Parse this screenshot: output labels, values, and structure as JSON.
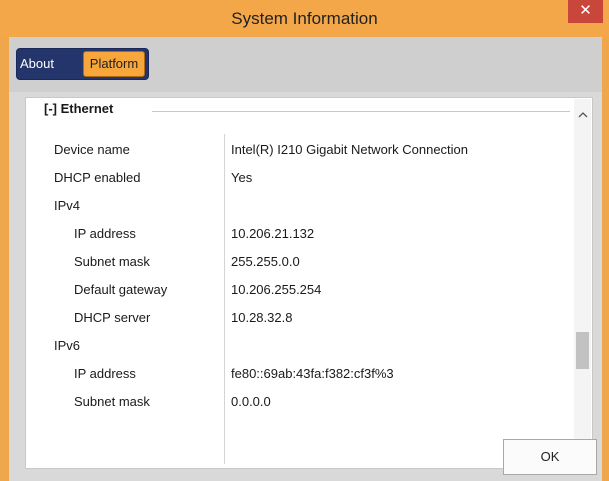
{
  "window": {
    "title": "System Information",
    "close_glyph": "✕",
    "accent_color": "#f3a748",
    "close_color": "#c9463a"
  },
  "tabs": [
    {
      "label": "About",
      "selected": false
    },
    {
      "label": "Platform",
      "selected": true
    }
  ],
  "section": {
    "header": "[-] Ethernet"
  },
  "rows": [
    {
      "label": "Device name",
      "value": "Intel(R) I210 Gigabit Network Connection"
    },
    {
      "label": "DHCP enabled",
      "value": "Yes"
    },
    {
      "label": "IPv4",
      "value": ""
    },
    {
      "label": "IP address",
      "value": "10.206.21.132"
    },
    {
      "label": "Subnet mask",
      "value": "255.255.0.0"
    },
    {
      "label": "Default gateway",
      "value": "10.206.255.254"
    },
    {
      "label": "DHCP server",
      "value": "10.28.32.8"
    },
    {
      "label": "IPv6",
      "value": ""
    },
    {
      "label": "IP address",
      "value": "fe80::69ab:43fa:f382:cf3f%3"
    },
    {
      "label": "Subnet mask",
      "value": "0.0.0.0"
    }
  ],
  "scrollbar": {
    "up_icon": "chevron-up-icon",
    "down_icon": "chevron-down-icon"
  },
  "footer": {
    "ok_label": "OK"
  }
}
